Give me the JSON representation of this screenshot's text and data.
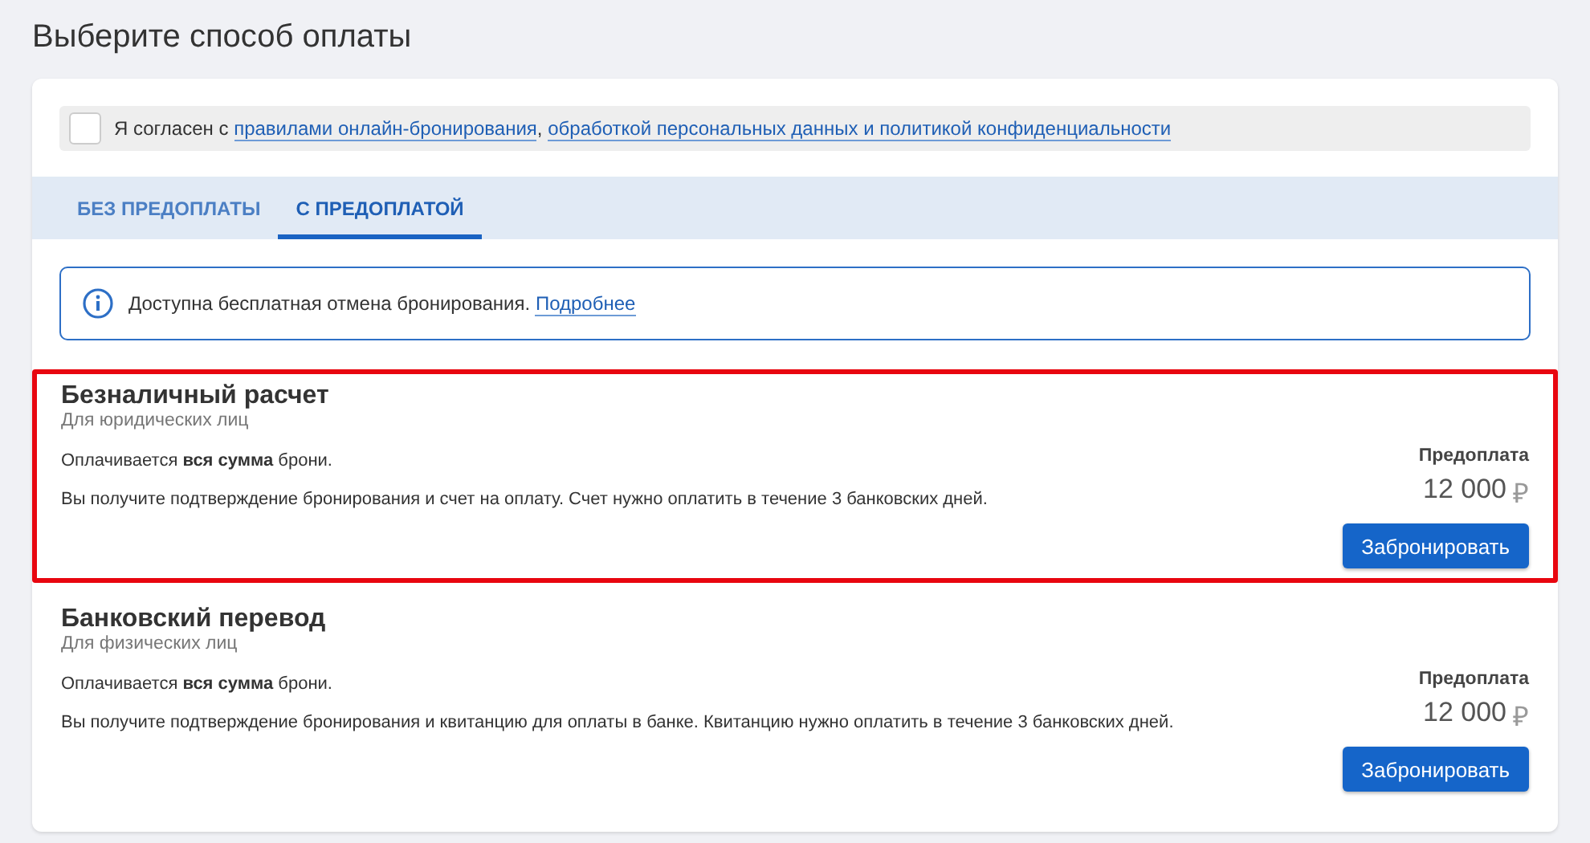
{
  "title": "Выберите способ оплаты",
  "consent": {
    "checked": false,
    "prefix": "Я согласен с",
    "separator": ",",
    "links": [
      "правилами онлайн-бронирования",
      "обработкой персональных данных и политикой конфиденциальности"
    ]
  },
  "tabs": [
    {
      "label": "БЕЗ ПРЕДОПЛАТЫ",
      "selected": false
    },
    {
      "label": "С ПРЕДОПЛАТОЙ",
      "selected": true
    }
  ],
  "notice": {
    "text": "Доступна бесплатная отмена бронирования.",
    "link": "Подробнее"
  },
  "options": [
    {
      "title": "Безналичный расчет",
      "subtitle": "Для юридических лиц",
      "highlighted": true,
      "line1": "Оплачивается **вся сумма** брони.",
      "line2": "Вы получите подтверждение бронирования и счет на оплату. Счет нужно оплатить в течение 3 банковских дней.",
      "price_label": "Предоплата",
      "price": "12 000",
      "currency": "₽",
      "button": "Забронировать"
    },
    {
      "title": "Банковский перевод",
      "subtitle": "Для физических лиц",
      "highlighted": false,
      "line1": "Оплачивается **вся сумма** брони.",
      "line2": "Вы получите подтверждение бронирования и квитанцию для оплаты в банке. Квитанцию нужно оплатить в течение 3 банковских дней.",
      "price_label": "Предоплата",
      "price": "12 000",
      "currency": "₽",
      "button": "Забронировать"
    }
  ]
}
